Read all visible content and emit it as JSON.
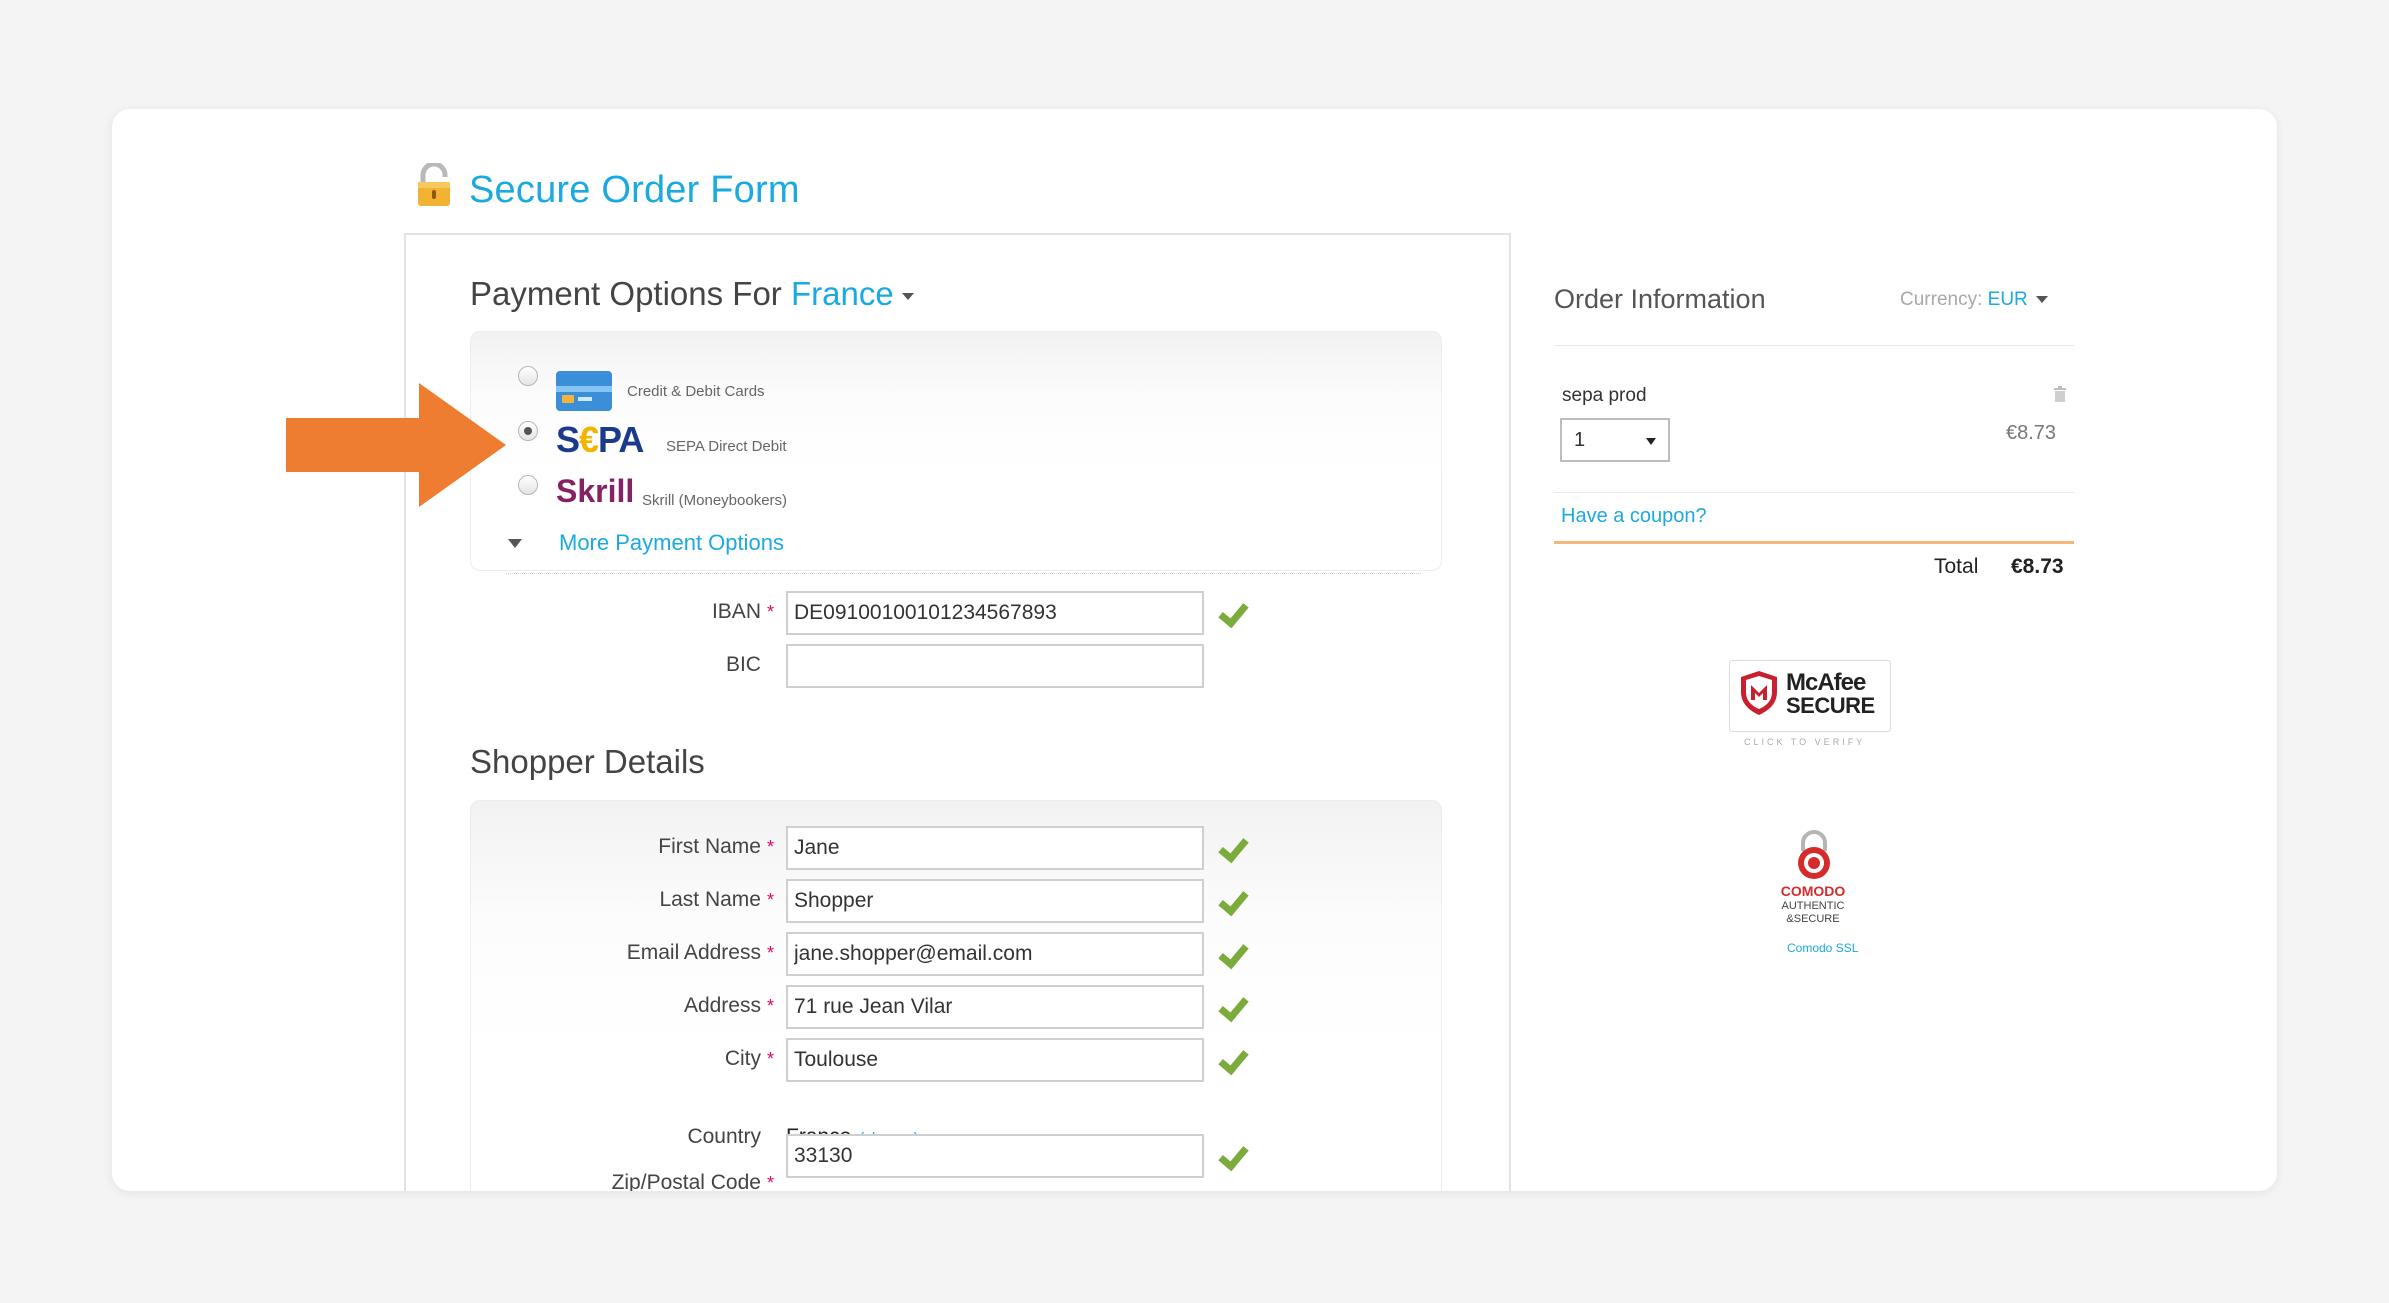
{
  "page": {
    "title": "Secure Order Form",
    "lock_icon": "padlock-icon"
  },
  "payment": {
    "heading_prefix": "Payment Options For",
    "country": "France",
    "options": [
      {
        "label": "Credit & Debit Cards",
        "icon": "credit-card-icon",
        "selected": false
      },
      {
        "label": "SEPA Direct Debit",
        "logo_text": "SEPA",
        "selected": true
      },
      {
        "label": "Skrill (Moneybookers)",
        "logo_text": "Skrill",
        "selected": false
      }
    ],
    "more_options": "More Payment Options",
    "iban_label": "IBAN",
    "iban_value": "DE09100100101234567893",
    "bic_label": "BIC",
    "bic_value": ""
  },
  "shopper": {
    "heading": "Shopper Details",
    "fields": [
      {
        "label": "First Name",
        "value": "Jane"
      },
      {
        "label": "Last Name",
        "value": "Shopper"
      },
      {
        "label": "Email Address",
        "value": "jane.shopper@email.com"
      },
      {
        "label": "Address",
        "value": "71 rue Jean Vilar"
      },
      {
        "label": "City",
        "value": "Toulouse"
      }
    ],
    "country_label": "Country",
    "country_value": "France",
    "country_change": "(change)",
    "zip_label": "Zip/Postal Code",
    "zip_value": "33130"
  },
  "order": {
    "title": "Order Information",
    "currency_label": "Currency:",
    "currency_value": "EUR",
    "product_name": "sepa prod",
    "quantity": "1",
    "price": "€8.73",
    "coupon": "Have a coupon?",
    "total_label": "Total",
    "total_value": "€8.73"
  },
  "badges": {
    "mcafee_name": "McAfee",
    "mcafee_secure": "SECURE",
    "mcafee_verify": "CLICK TO VERIFY",
    "comodo_name": "COMODO",
    "comodo_line1": "AUTHENTIC",
    "comodo_line2": "&SECURE",
    "comodo_ssl": "Comodo SSL"
  },
  "colors": {
    "accent": "#1ba9e1",
    "arrow": "#ee7d31",
    "valid_check": "#7bab3b",
    "divider": "#f7b778"
  }
}
